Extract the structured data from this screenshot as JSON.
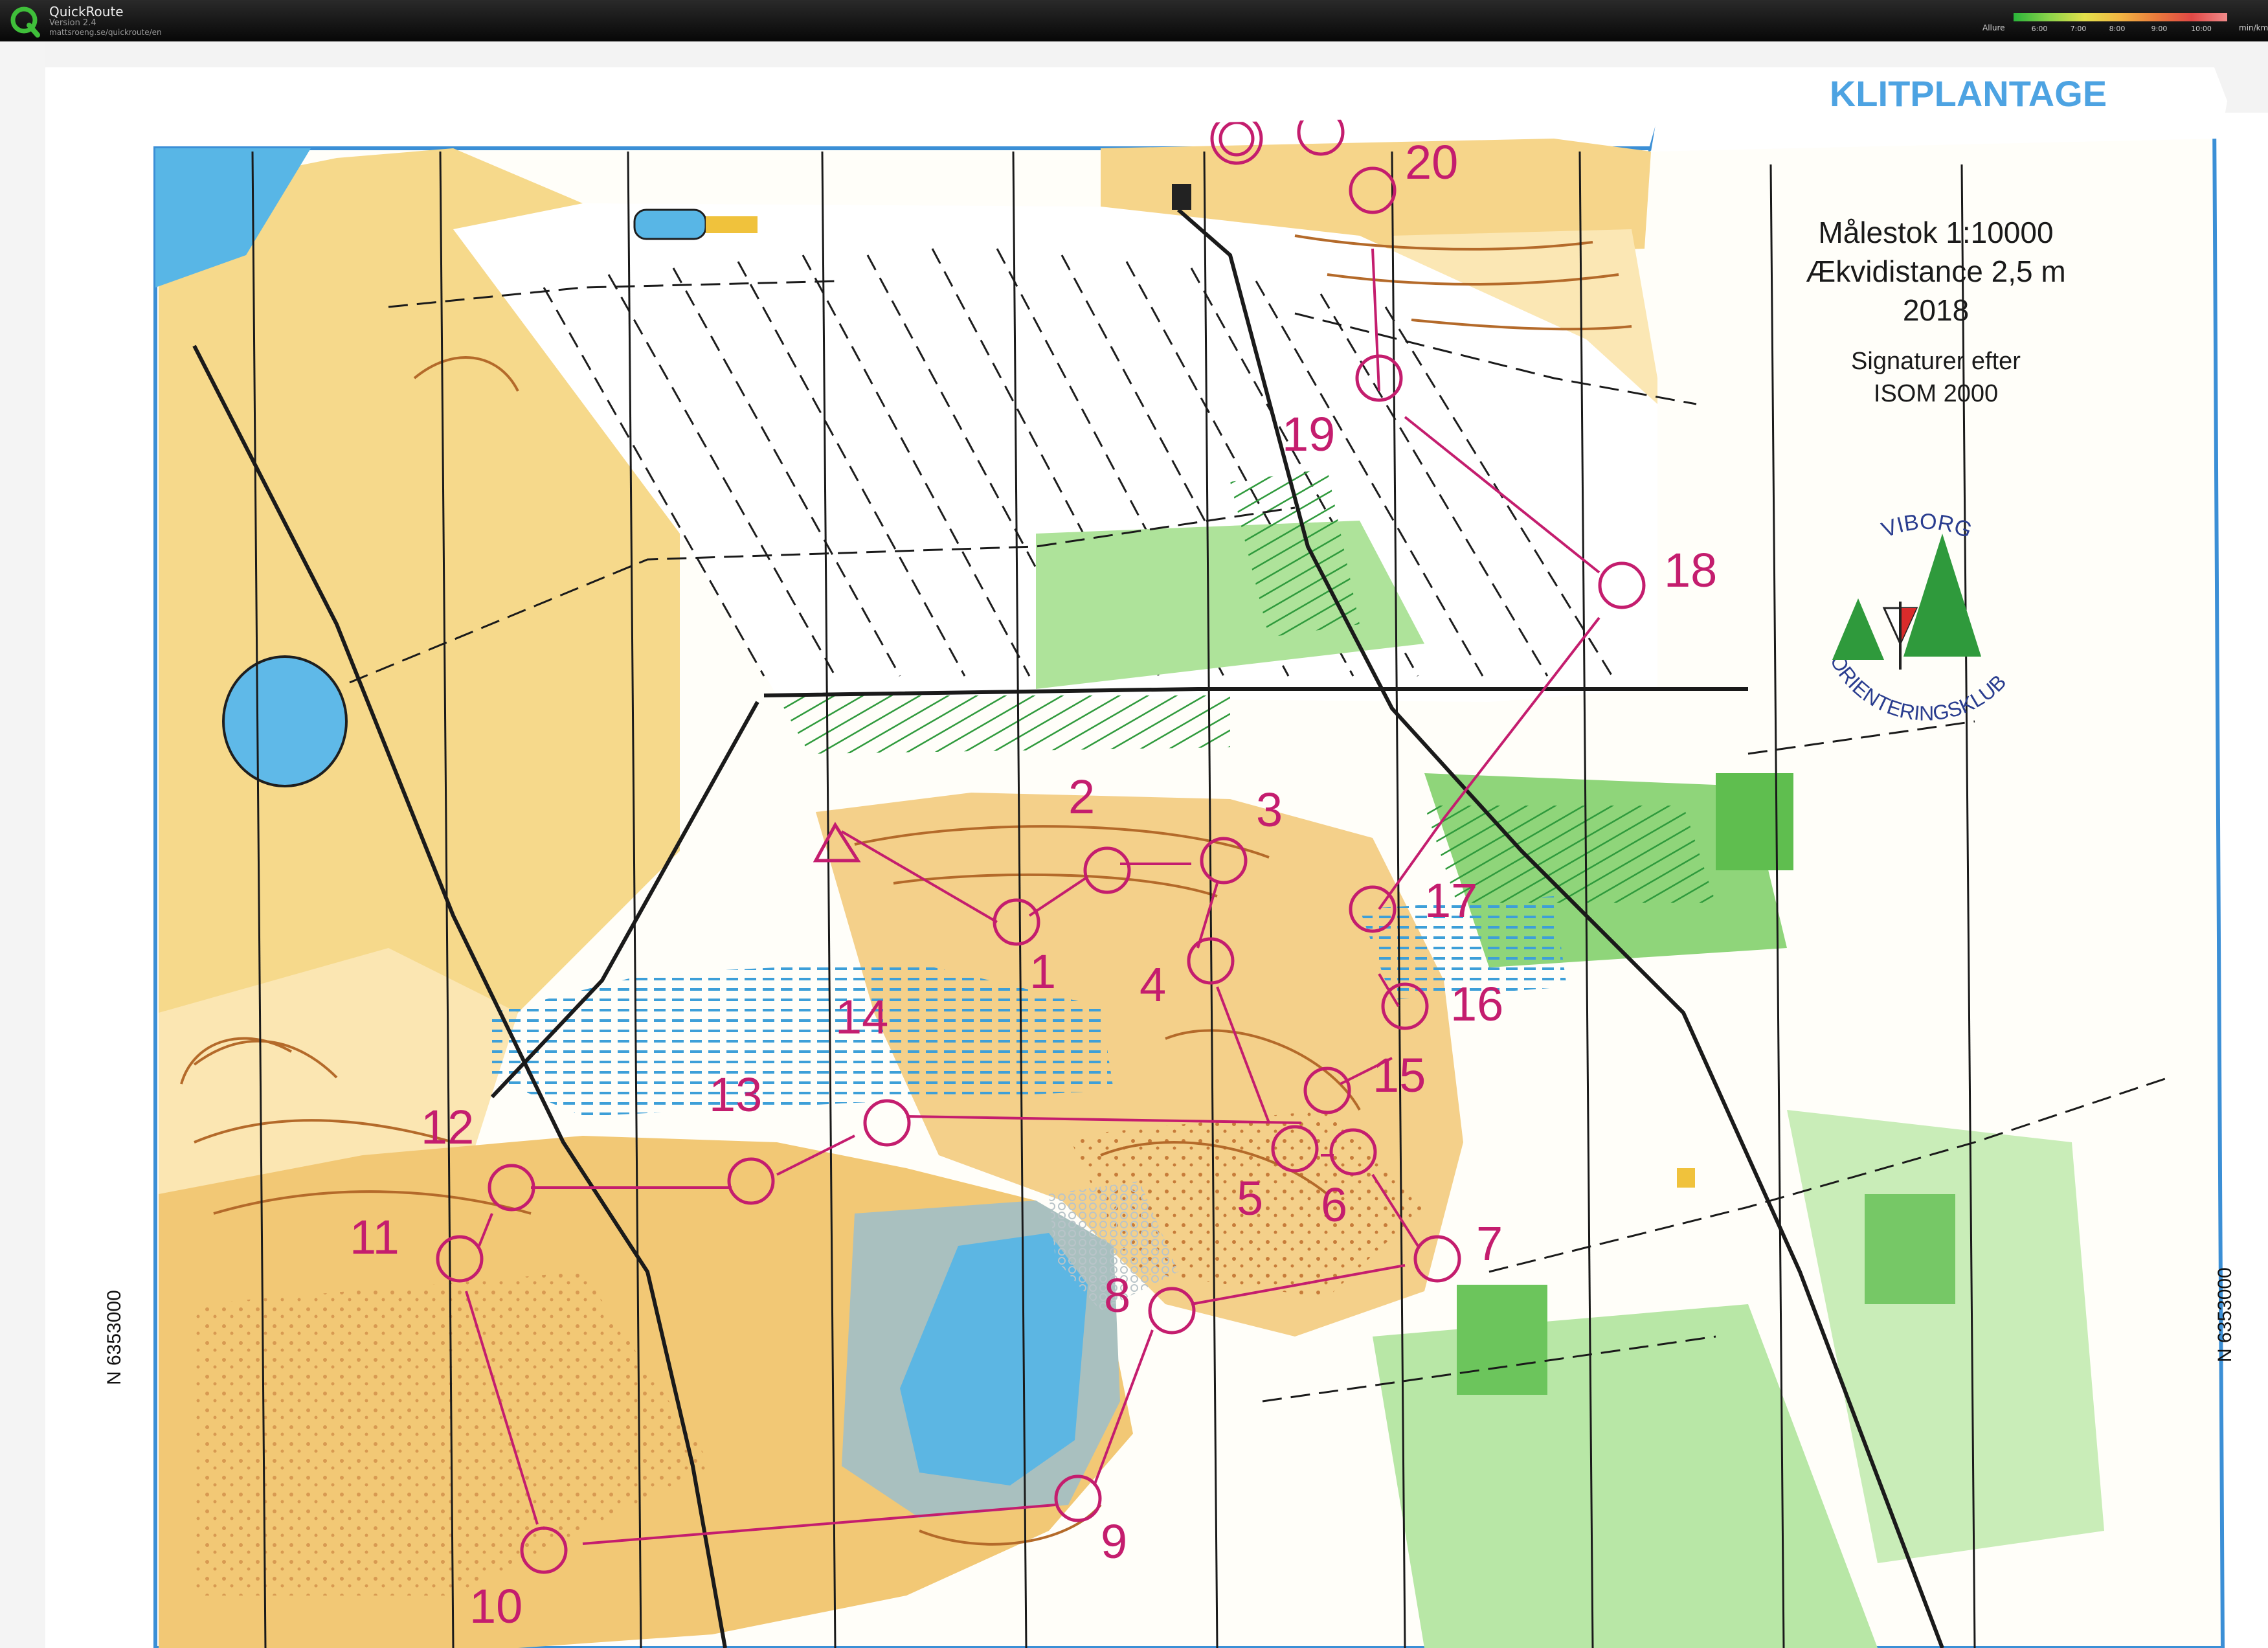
{
  "app": {
    "name": "QuickRoute",
    "version": "Version 2.4",
    "url": "mattsroeng.se/quickroute/en",
    "pace_label": "Allure",
    "pace_ticks": [
      "6:00",
      "7:00",
      "8:00",
      "9:00",
      "10:00"
    ],
    "pace_unit": "min/km"
  },
  "map": {
    "header_text": "KLITPLANTAGE",
    "scale": "Målestok 1:10000",
    "contour": "Ækvidistance 2,5 m",
    "year": "2018",
    "symbols_1": "Signaturer efter",
    "symbols_2": "ISOM 2000",
    "club_top": "VIBORG",
    "club_bottom": "ORIENTERINGSKLUB",
    "grid_left": "N 6353000",
    "grid_right": "N 6353000",
    "colors": {
      "course": "#c41d6e",
      "open": "#f3cd77",
      "rough": "#fbe7b0",
      "forest_green": "#86cf6f",
      "water": "#58b6e6",
      "contour": "#b46a2a"
    }
  },
  "controls": [
    {
      "id": "control-1",
      "label": "1"
    },
    {
      "id": "control-2",
      "label": "2"
    },
    {
      "id": "control-3",
      "label": "3"
    },
    {
      "id": "control-4",
      "label": "4"
    },
    {
      "id": "control-5",
      "label": "5"
    },
    {
      "id": "control-6",
      "label": "6"
    },
    {
      "id": "control-7",
      "label": "7"
    },
    {
      "id": "control-8",
      "label": "8"
    },
    {
      "id": "control-9",
      "label": "9"
    },
    {
      "id": "control-10",
      "label": "10"
    },
    {
      "id": "control-11",
      "label": "11"
    },
    {
      "id": "control-12",
      "label": "12"
    },
    {
      "id": "control-13",
      "label": "13"
    },
    {
      "id": "control-14",
      "label": "14"
    },
    {
      "id": "control-15",
      "label": "15"
    },
    {
      "id": "control-16",
      "label": "16"
    },
    {
      "id": "control-17",
      "label": "17"
    },
    {
      "id": "control-18",
      "label": "18"
    },
    {
      "id": "control-19",
      "label": "19"
    },
    {
      "id": "control-20",
      "label": "20"
    }
  ]
}
